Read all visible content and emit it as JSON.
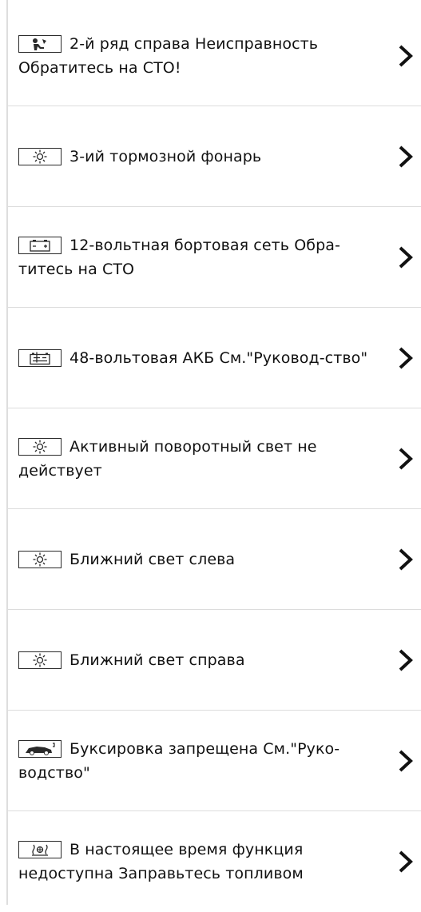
{
  "messages": [
    {
      "icon": "airbag-passenger-icon",
      "text": "2-й ряд справа Неисправность Обратитесь на СТО!"
    },
    {
      "icon": "bulb-icon",
      "text": "3-ий тормозной фонарь"
    },
    {
      "icon": "battery-12v-icon",
      "text": "12-вольтная бортовая сеть Обра-титесь на СТО"
    },
    {
      "icon": "battery-48v-icon",
      "text": "48-вольтовая АКБ См.\"Руковод-ство\""
    },
    {
      "icon": "bulb-icon",
      "text": "Активный поворотный свет не действует"
    },
    {
      "icon": "bulb-icon",
      "text": "Ближний свет слева"
    },
    {
      "icon": "bulb-icon",
      "text": "Ближний свет справа"
    },
    {
      "icon": "tow-away-icon",
      "text": "Буксировка запрещена См.\"Руко-водство\""
    },
    {
      "icon": "fuel-heater-icon",
      "text": "В настоящее время функция недоступна Заправьтесь топливом"
    }
  ]
}
